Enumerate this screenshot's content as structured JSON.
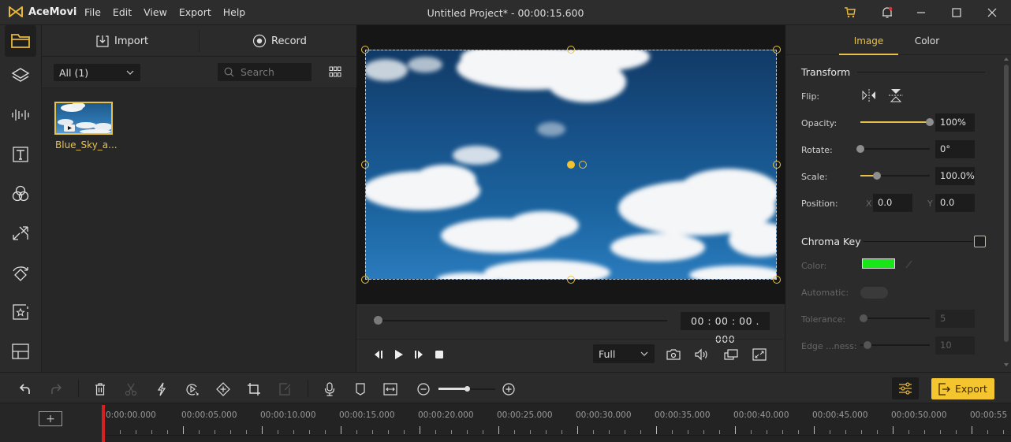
{
  "app": {
    "name": "AceMovi",
    "window_title": "Untitled Project* - 00:00:15.600",
    "menu": [
      "File",
      "Edit",
      "View",
      "Export",
      "Help"
    ],
    "titlebar_icons": [
      "cart-icon",
      "notification-bell-icon",
      "minimize-icon",
      "maximize-icon",
      "close-icon"
    ]
  },
  "sidebar": {
    "items": [
      {
        "name": "media",
        "icon": "folder-icon",
        "active": true
      },
      {
        "name": "layers",
        "icon": "layers-icon"
      },
      {
        "name": "audio",
        "icon": "audio-wave-icon"
      },
      {
        "name": "text",
        "icon": "text-icon"
      },
      {
        "name": "filters",
        "icon": "filters-circles-icon"
      },
      {
        "name": "transitions",
        "icon": "transition-arrows-icon"
      },
      {
        "name": "overlays",
        "icon": "rotate-diamond-icon"
      },
      {
        "name": "elements",
        "icon": "star-frame-icon"
      },
      {
        "name": "split-screen",
        "icon": "split-screen-icon"
      }
    ]
  },
  "media": {
    "import_label": "Import",
    "record_label": "Record",
    "filter_value": "All (1)",
    "search_placeholder": "Search",
    "items": [
      {
        "name": "Blue_Sky_a...",
        "type": "video"
      }
    ]
  },
  "player": {
    "timecode": "00 : 00 : 00 . 000",
    "progress": 0,
    "quality": "Full"
  },
  "properties": {
    "tabs": [
      "Image",
      "Color"
    ],
    "active_tab": "Image",
    "transform": {
      "title": "Transform",
      "flip_label": "Flip:",
      "opacity_label": "Opacity:",
      "opacity_value": "100%",
      "opacity_fraction": 1.0,
      "rotate_label": "Rotate:",
      "rotate_value": "0°",
      "rotate_fraction": 0.0,
      "scale_label": "Scale:",
      "scale_value": "100.0%",
      "scale_fraction": 0.24,
      "position_label": "Position:",
      "x_label": "X",
      "x_value": "0.0",
      "y_label": "Y",
      "y_value": "0.0"
    },
    "chroma_key": {
      "title": "Chroma Key",
      "enabled": false,
      "color_label": "Color:",
      "key_color": "#19e619",
      "automatic_label": "Automatic:",
      "tolerance_label": "Tolerance:",
      "tolerance_value": "5",
      "tolerance_fraction": 0.05,
      "edge_label": "Edge ...ness:",
      "edge_value": "10",
      "edge_fraction": 0.1
    }
  },
  "toolbar": {
    "export_label": "Export",
    "zoom_fraction": 0.5
  },
  "timeline": {
    "ticks": [
      "0:00:00.000",
      "00:00:05.000",
      "00:00:10.000",
      "00:00:15.000",
      "00:00:20.000",
      "00:00:25.000",
      "00:00:30.000",
      "00:00:35.000",
      "00:00:40.000",
      "00:00:45.000",
      "00:00:50.000",
      "00:00:55"
    ]
  },
  "colors": {
    "accent": "#e8c14a",
    "export_button": "#f5c530",
    "playhead": "#d92020"
  }
}
